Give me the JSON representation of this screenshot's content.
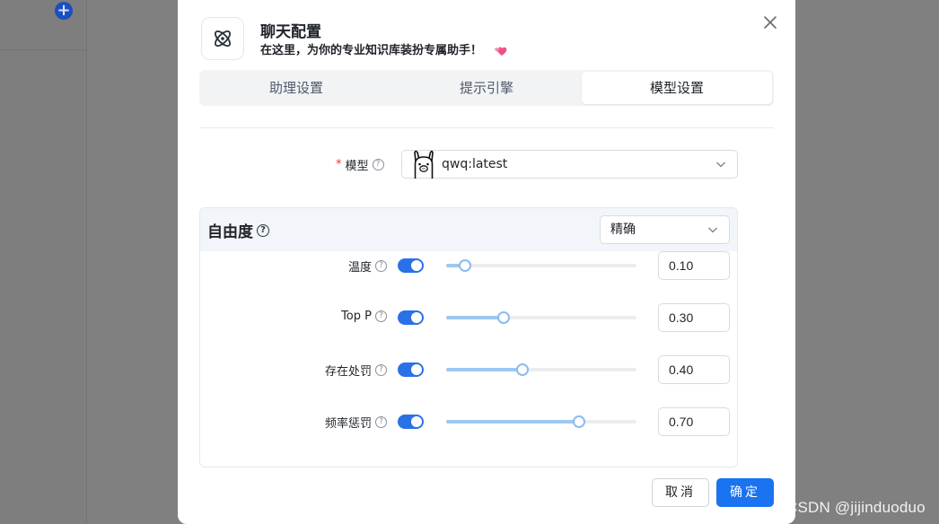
{
  "background": {
    "add_icon": "plus-circle-icon",
    "watermark": "CSDN @jijinduoduo"
  },
  "dialog": {
    "title": "聊天配置",
    "subtitle": "在这里，为你的专业知识库装扮专属助手！",
    "logo_icon": "atom-icon",
    "decor_icon": "two-hearts-icon",
    "close_icon": "close-icon",
    "tabs": [
      {
        "label": "助理设置",
        "active": false
      },
      {
        "label": "提示引擎",
        "active": false
      },
      {
        "label": "模型设置",
        "active": true
      }
    ],
    "model": {
      "label": "模型",
      "required_mark": "*",
      "value": "qwq:latest",
      "icon": "llama-icon"
    },
    "freedom": {
      "title": "自由度",
      "preset": "精确",
      "params": [
        {
          "label": "温度",
          "enabled": true,
          "value": "0.10",
          "fraction": 0.1
        },
        {
          "label": "Top P",
          "enabled": true,
          "value": "0.30",
          "fraction": 0.3
        },
        {
          "label": "存在处罚",
          "enabled": true,
          "value": "0.40",
          "fraction": 0.4
        },
        {
          "label": "频率惩罚",
          "enabled": true,
          "value": "0.70",
          "fraction": 0.7
        }
      ]
    },
    "buttons": {
      "cancel": "取消",
      "ok": "确定"
    },
    "colors": {
      "primary": "#1a73f0",
      "slider_fill": "#9ec7f2",
      "required": "#e03b3b"
    }
  }
}
